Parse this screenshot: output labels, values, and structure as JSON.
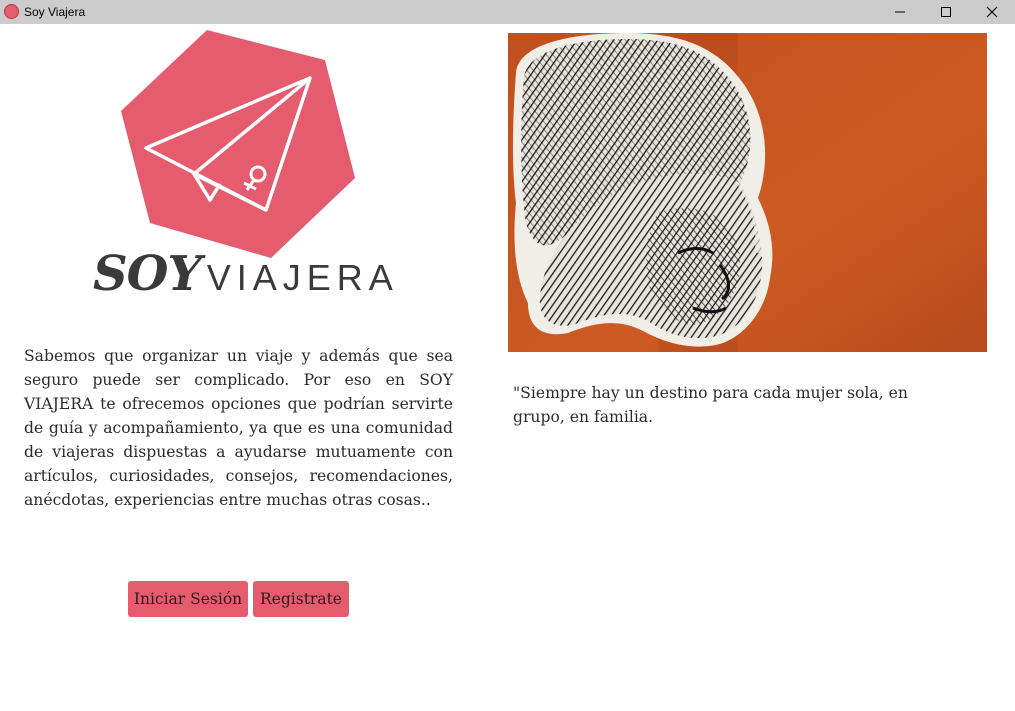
{
  "window": {
    "title": "Soy Viajera",
    "app_icon": "rose-icon",
    "controls": [
      "minimize-icon",
      "maximize-icon",
      "close-icon"
    ]
  },
  "logo": {
    "brand_bold": "SOY",
    "brand_light": "VIAJERA",
    "emblem": "paper-plane-female-symbol-icon",
    "color": "#e55c6e"
  },
  "description": "Sabemos que organizar un viaje y además que sea seguro puede ser complicado. Por eso en SOY VIAJERA te ofrecemos opciones que podrían servirte de guía y acompañamiento, ya que es una comunidad de viajeras dispuestas a ayudarse mutuamente con artículos, curiosidades, consejos, recomendaciones, anécdotas, experiencias entre muchas otras cosas..",
  "buttons": {
    "login": "Iniciar Sesión",
    "register": "Registrate",
    "color": "#e55c6e"
  },
  "image": {
    "subject": "street-art woman face on orange wall",
    "background_color": "#c6541f"
  },
  "quote": "\"Siempre hay un destino para cada mujer sola, en grupo, en familia."
}
